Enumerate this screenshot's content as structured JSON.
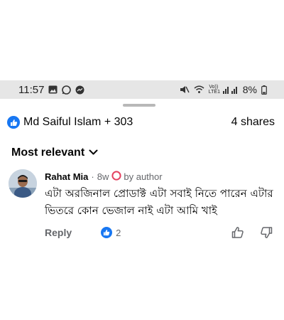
{
  "status_bar": {
    "time": "11:57",
    "signal_label": "Vo)) LTE1",
    "battery": "8%"
  },
  "reactions": {
    "reactors": "Md Saiful Islam + 303",
    "shares": "4 shares",
    "accent": "#1877f2"
  },
  "sort": {
    "label": "Most relevant"
  },
  "comment": {
    "author": "Rahat Mia",
    "time": "8w",
    "badge": "by author",
    "text": "এটা অরজিনাল প্রোডাক্ট এটা সবাই নিতে পারেন এটার ভিতরে কোন ভেজাল নাই এটা আমি খাই",
    "reply_label": "Reply",
    "like_count": "2"
  }
}
